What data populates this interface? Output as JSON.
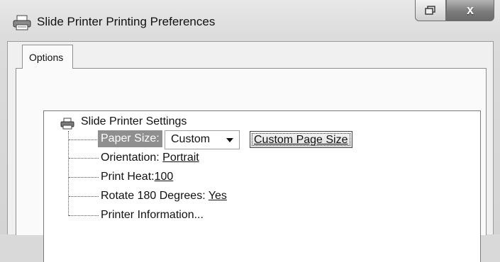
{
  "window": {
    "title": "Slide Printer Printing Preferences",
    "buttons": {
      "restore_icon": "restore-icon",
      "close_label": "x"
    }
  },
  "tabs": [
    {
      "label": "Options",
      "selected": true
    }
  ],
  "tree": {
    "root": {
      "label": "Slide Printer Settings",
      "icon": "printer-icon"
    },
    "items": [
      {
        "label": "Paper Size:",
        "value": "Custom",
        "button": "Custom Page Size",
        "selected": true
      },
      {
        "label": "Orientation:",
        "value": "Portrait"
      },
      {
        "label": "Print Heat:",
        "value": "100"
      },
      {
        "label": "Rotate 180 Degrees:",
        "value": "Yes"
      },
      {
        "label": "Printer Information..."
      }
    ]
  },
  "colors": {
    "selection_highlight": "#8f8f8f",
    "close_button": "#7d7d7d"
  }
}
